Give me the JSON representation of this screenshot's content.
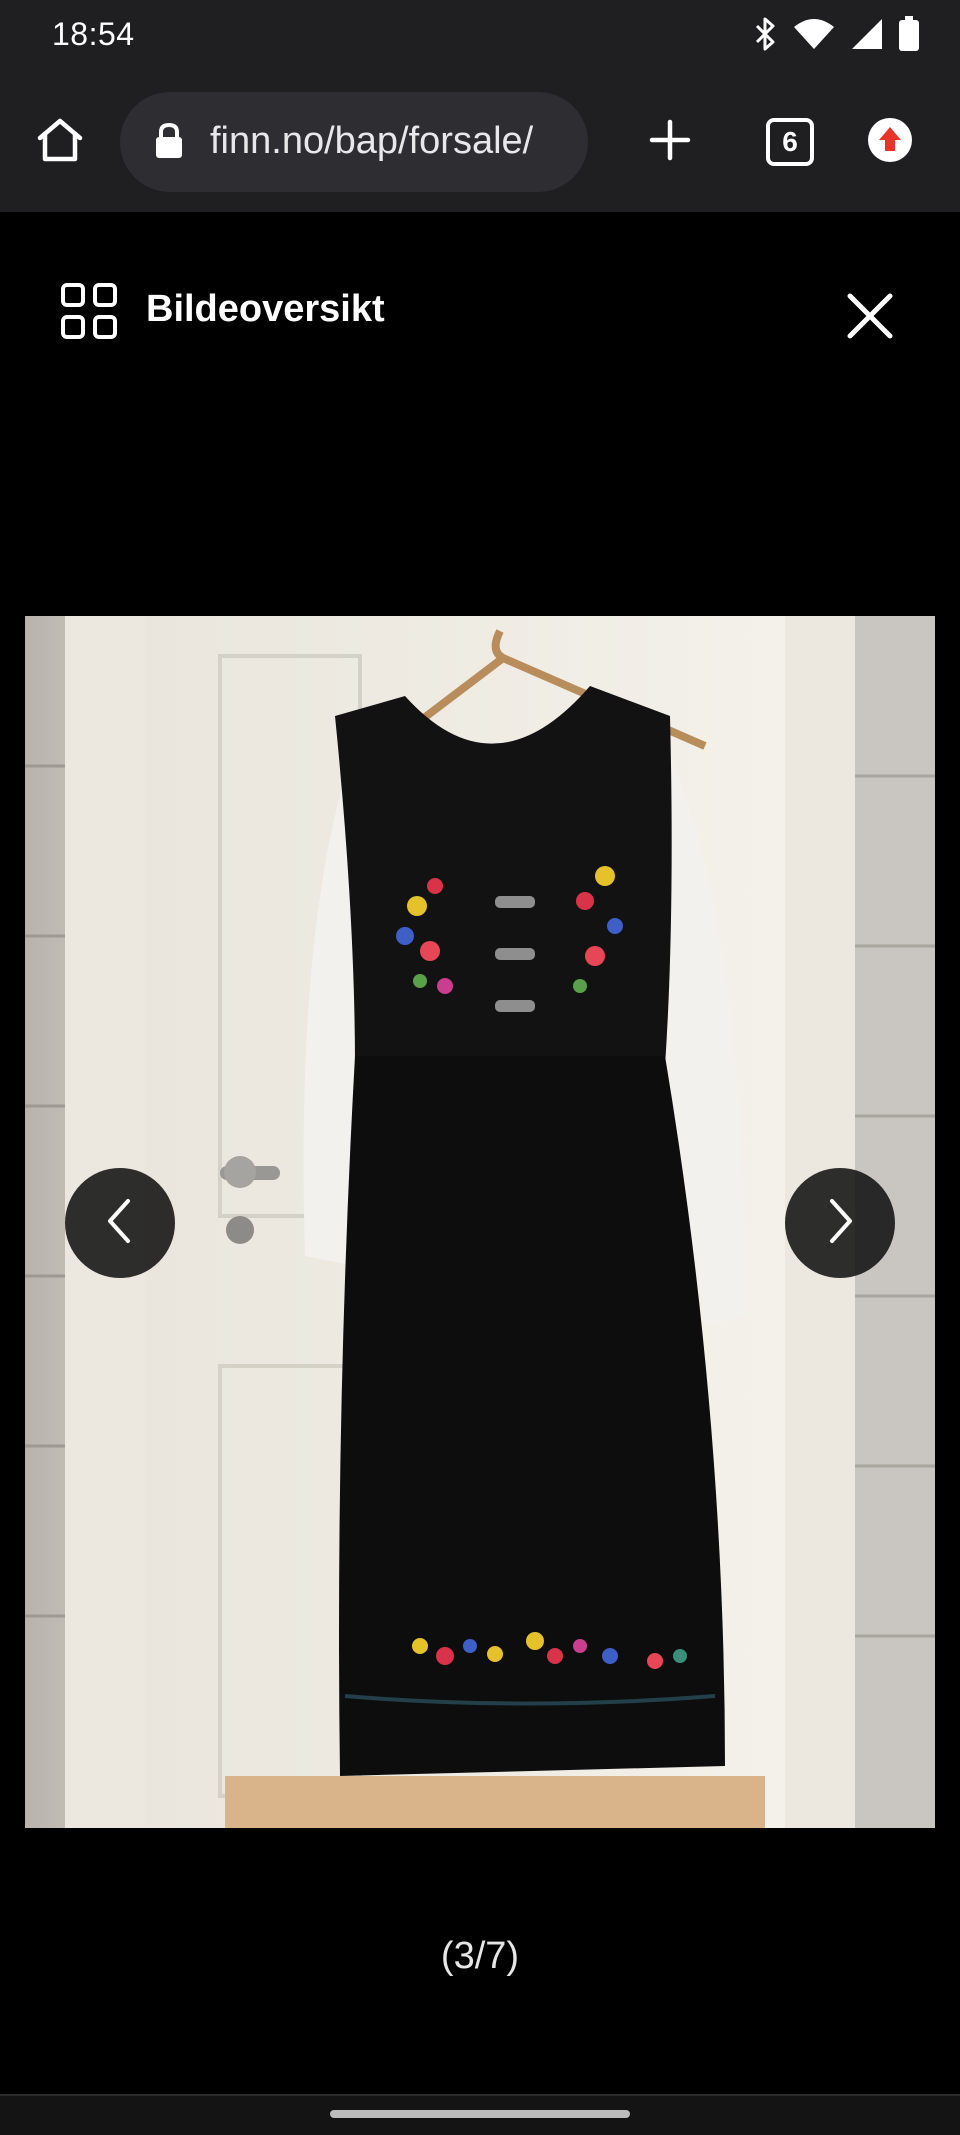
{
  "status_bar": {
    "time": "18:54",
    "icons": [
      "bluetooth-icon",
      "wifi-icon",
      "signal-icon",
      "battery-icon"
    ]
  },
  "browser": {
    "url": "finn.no/bap/forsale/",
    "tab_count": "6",
    "icons": [
      "home-icon",
      "lock-icon",
      "new-tab-icon",
      "extension-icon"
    ]
  },
  "viewer": {
    "overview_label": "Bildeoversikt",
    "counter": "(3/7)",
    "icons": [
      "grid-icon",
      "close-icon",
      "chevron-left-icon",
      "chevron-right-icon"
    ]
  },
  "colors": {
    "toolbar": "#1f1f21",
    "url_pill": "#2e2e32",
    "background": "#000000",
    "extension_accent": "#e8332b"
  }
}
